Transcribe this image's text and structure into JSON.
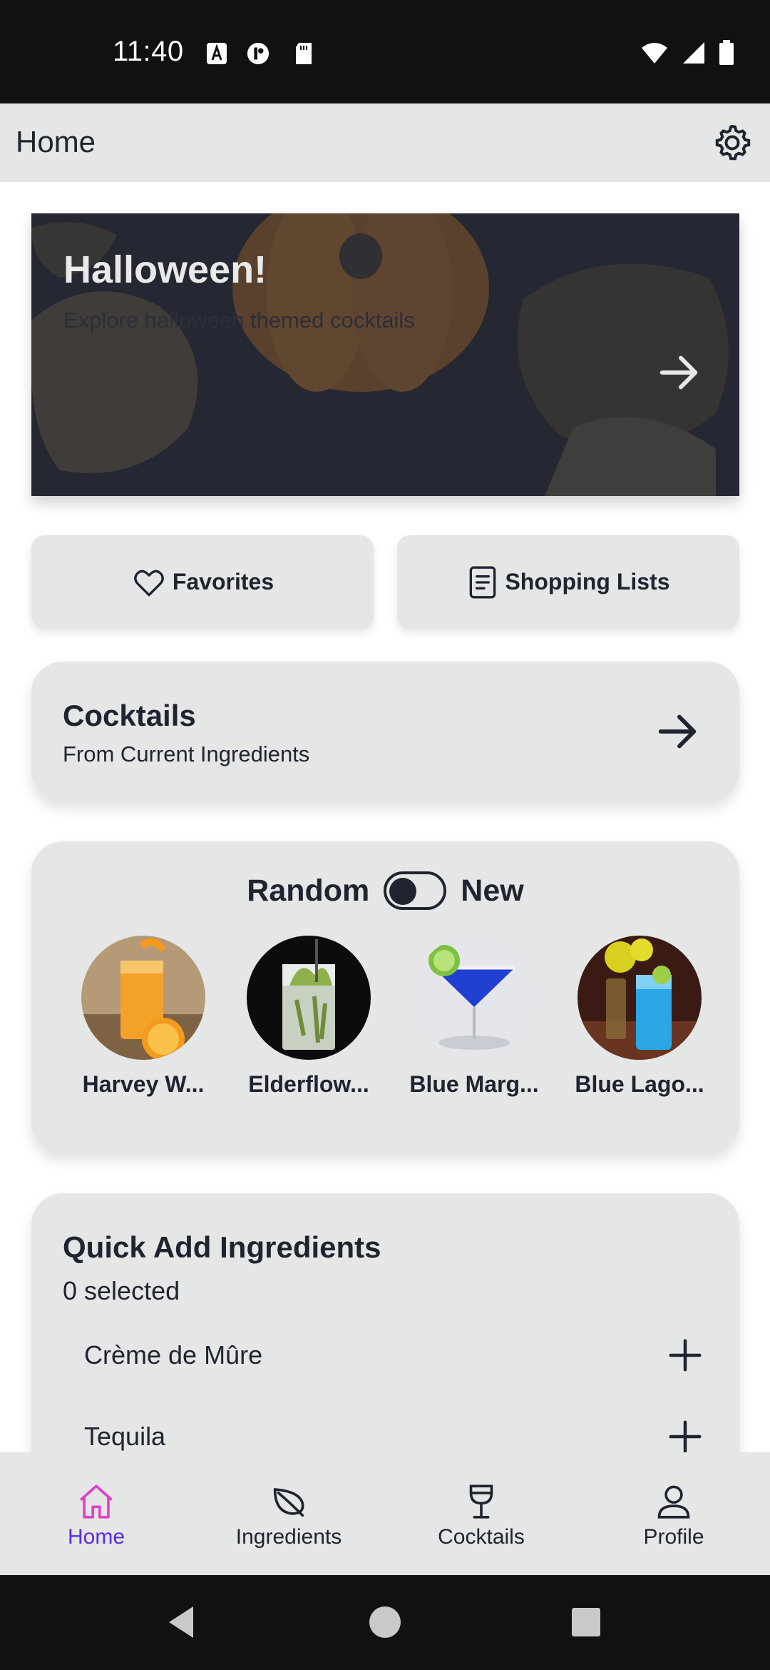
{
  "status_bar": {
    "time": "11:40"
  },
  "app_bar": {
    "title": "Home",
    "settings_icon": "gear-icon"
  },
  "hero": {
    "title": "Halloween!",
    "subtitle": "Explore halloween themed cocktails"
  },
  "quick_buttons": {
    "favorites_label": "Favorites",
    "shopping_label": "Shopping Lists"
  },
  "cocktails_card": {
    "title": "Cocktails",
    "subtitle": "From Current Ingredients"
  },
  "random_card": {
    "left_label": "Random",
    "right_label": "New",
    "toggle_state": "off",
    "drinks": [
      {
        "name": "Harvey W..."
      },
      {
        "name": "Elderflow..."
      },
      {
        "name": "Blue Marg..."
      },
      {
        "name": "Blue Lago..."
      }
    ]
  },
  "quick_add": {
    "title": "Quick Add Ingredients",
    "selected_text": "0 selected",
    "ingredients": [
      {
        "name": "Crème de Mûre"
      },
      {
        "name": "Tequila"
      }
    ]
  },
  "bottom_nav": {
    "items": [
      {
        "label": "Home",
        "icon": "home-icon",
        "active": true
      },
      {
        "label": "Ingredients",
        "icon": "leaf-icon",
        "active": false
      },
      {
        "label": "Cocktails",
        "icon": "cocktail-glass-icon",
        "active": false
      },
      {
        "label": "Profile",
        "icon": "person-icon",
        "active": false
      }
    ]
  },
  "colors": {
    "accent_active_label": "#5b2be0",
    "accent_active_icon": "#e040c8",
    "card_background": "#e5e6e6",
    "text_primary": "#1f2430"
  }
}
